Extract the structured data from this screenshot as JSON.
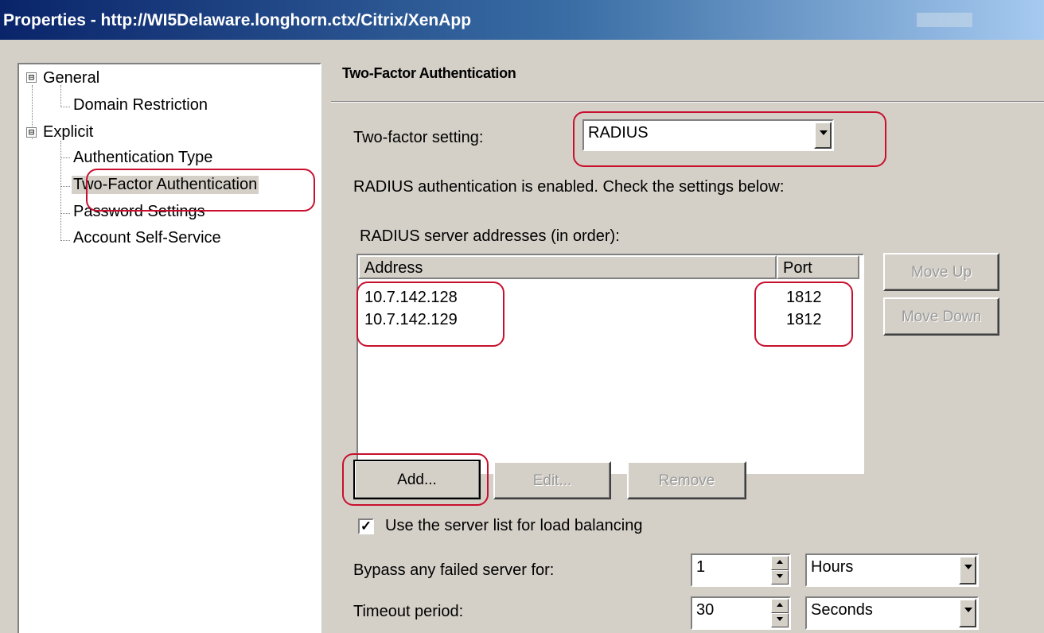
{
  "window": {
    "title": "Properties - http://WI5Delaware.longhorn.ctx/Citrix/XenApp"
  },
  "tree": {
    "items": [
      {
        "label": "General",
        "expander": "⊟"
      },
      {
        "label": "Domain Restriction"
      },
      {
        "label": "Explicit",
        "expander": "⊟"
      },
      {
        "label": "Authentication Type"
      },
      {
        "label": "Two-Factor Authentication"
      },
      {
        "label": "Password Settings"
      },
      {
        "label": "Account Self-Service"
      }
    ]
  },
  "panel": {
    "header": "Two-Factor Authentication",
    "two_factor_label": "Two-factor setting:",
    "two_factor_value": "RADIUS",
    "status_text": "RADIUS authentication is enabled. Check the settings below:",
    "servers_label": "RADIUS server addresses (in order):",
    "columns": {
      "address": "Address",
      "port": "Port"
    },
    "servers": [
      {
        "address": "10.7.142.128",
        "port": "1812"
      },
      {
        "address": "10.7.142.129",
        "port": "1812"
      }
    ],
    "buttons": {
      "move_up": "Move Up",
      "move_down": "Move Down",
      "add": "Add...",
      "edit": "Edit...",
      "remove": "Remove"
    },
    "load_balancing_label": "Use the server list for load balancing",
    "load_balancing_checked": true,
    "bypass_label": "Bypass any failed server for:",
    "bypass_value": "1",
    "bypass_unit": "Hours",
    "timeout_label": "Timeout period:",
    "timeout_value": "30",
    "timeout_unit": "Seconds"
  }
}
